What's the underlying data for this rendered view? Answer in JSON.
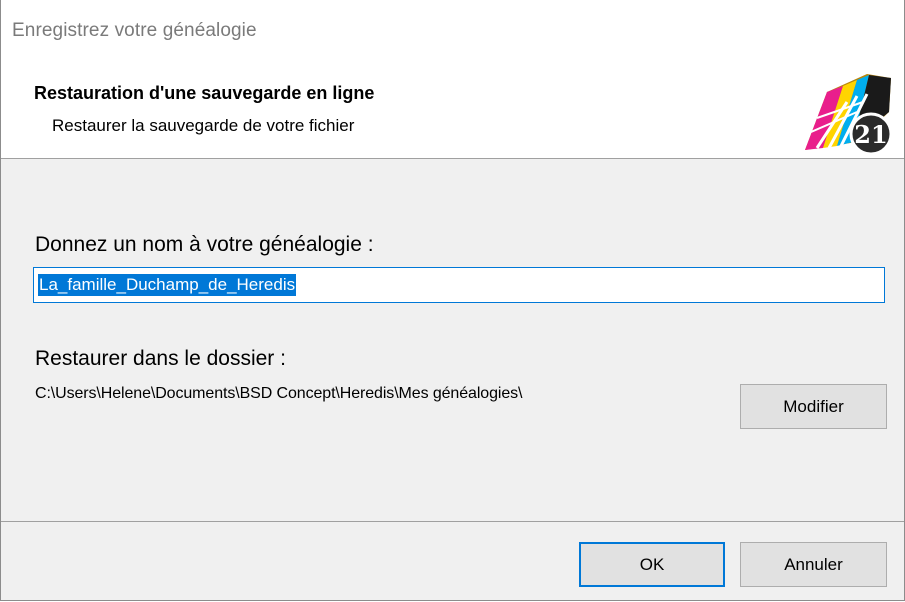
{
  "window": {
    "title": "Enregistrez votre généalogie"
  },
  "header": {
    "title": "Restauration d'une sauvegarde en ligne",
    "subtitle": "Restaurer la sauvegarde de votre fichier",
    "logo_icon": "heredis-21-logo",
    "logo_badge": "21"
  },
  "form": {
    "name_label": "Donnez un nom à votre généalogie  :",
    "name_value": "La_famille_Duchamp_de_Heredis",
    "folder_label": "Restaurer dans le dossier :",
    "folder_path": "C:\\Users\\Helene\\Documents\\BSD Concept\\Heredis\\Mes généalogies\\",
    "modify_button": "Modifier"
  },
  "footer": {
    "ok_button": "OK",
    "cancel_button": "Annuler"
  },
  "colors": {
    "accent": "#0078d7",
    "panel_bg": "#f0f0f0",
    "button_bg": "#e1e1e1"
  }
}
